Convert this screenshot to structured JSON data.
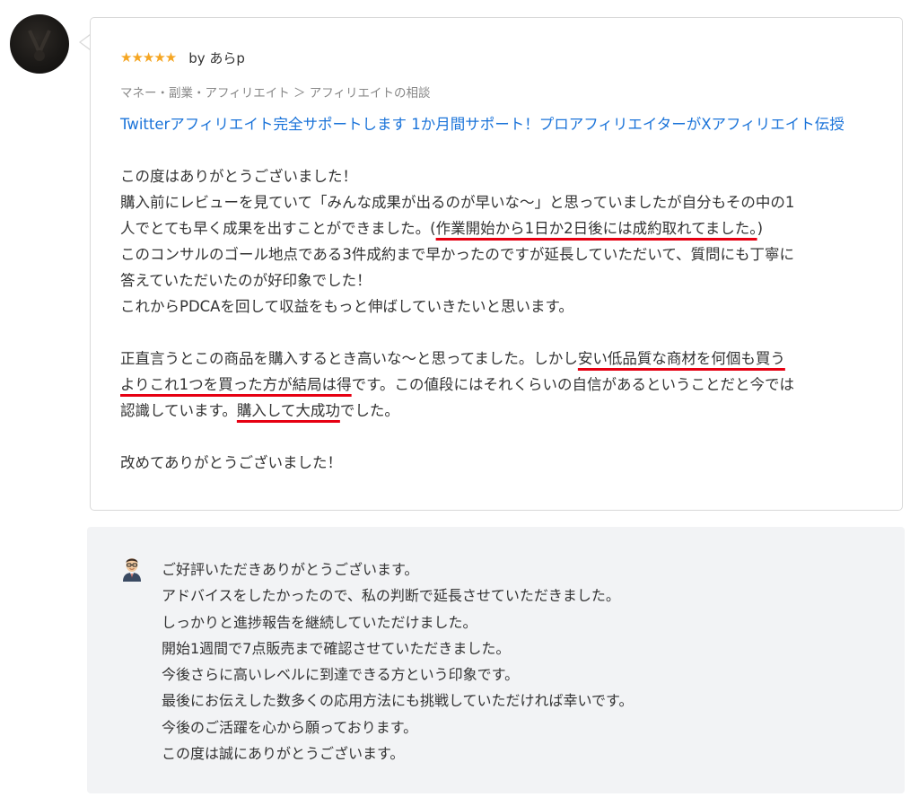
{
  "review": {
    "stars": "★★★★★",
    "reviewer": "by あらp",
    "breadcrumb": "マネー・副業・アフィリエイト ＞ アフィリエイトの相談",
    "service_title": "Twitterアフィリエイト完全サポートします 1か月間サポート！プロアフィリエイターがXアフィリエイト伝授",
    "body": {
      "l1": "この度はありがとうございました！",
      "l2": "購入前にレビューを見ていて「みんな成果が出るのが早いな〜」と思っていましたが自分もその中の1",
      "l3_pre": "人でとても早く成果を出すことができました。(",
      "l3_ul": "作業開始から1日か2日後には成約取れてました。",
      "l3_post": ")",
      "l4": "このコンサルのゴール地点である3件成約まで早かったのですが延長していただいて、質問にも丁寧に",
      "l5": "答えていただいたのが好印象でした！",
      "l6": "これからPDCAを回して収益をもっと伸ばしていきたいと思います。",
      "l8_pre": "正直言うとこの商品を購入するとき高いな〜と思ってました。しかし",
      "l8_ul": "安い低品質な商材を何個も買う",
      "l9_ul": "よりこれ1つを買った方が結局は得",
      "l9_post": "です。この値段にはそれくらいの自信があるということだと今では",
      "l10_pre": "認識しています。",
      "l10_ul": "購入して大成功",
      "l10_post": "でした。",
      "l12": "改めてありがとうございました！"
    }
  },
  "reply": {
    "lines": [
      "ご好評いただきありがとうございます。",
      "アドバイスをしたかったので、私の判断で延長させていただきました。",
      "しっかりと進捗報告を継続していただけました。",
      "開始1週間で7点販売まで確認させていただきました。",
      "今後さらに高いレベルに到達できる方という印象です。",
      "最後にお伝えした数多くの応用方法にも挑戦していただければ幸いです。",
      "今後のご活躍を心から願っております。",
      "この度は誠にありがとうございます。"
    ]
  },
  "colors": {
    "star": "#f5a623",
    "link": "#1a73d9",
    "underline": "#e60012",
    "reply_bg": "#f2f3f5"
  },
  "icons": {
    "reviewer_avatar": "user-avatar-icon",
    "seller_avatar": "seller-avatar-icon",
    "star": "star-icon"
  }
}
